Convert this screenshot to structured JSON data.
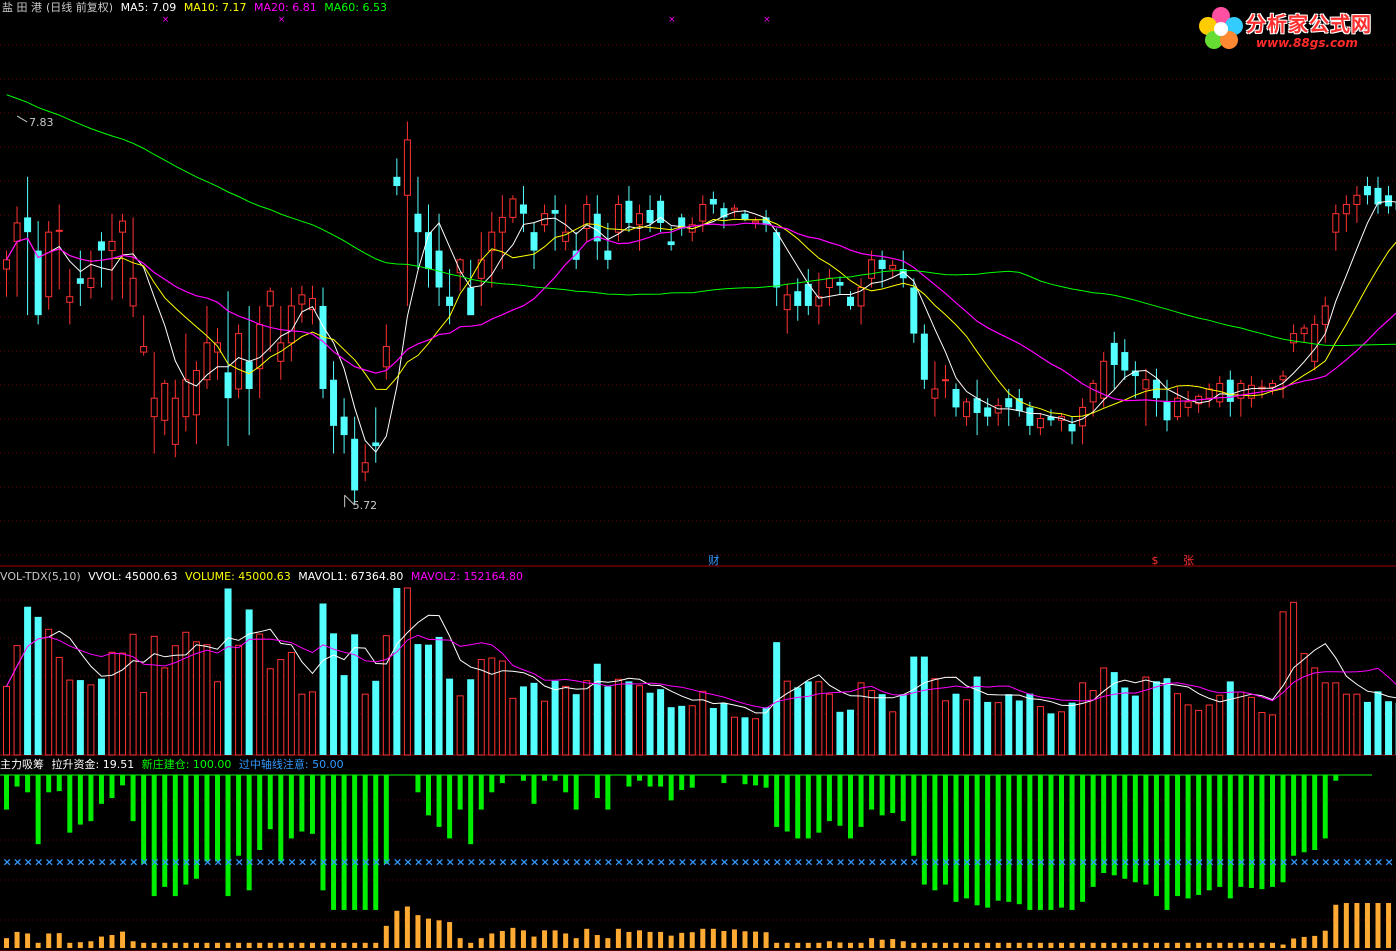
{
  "stock": {
    "name": "盐 田 港",
    "mode": "(日线 前复权)"
  },
  "ma_legend": [
    {
      "label": "MA5: 7.09",
      "color": "#ffffff"
    },
    {
      "label": "MA10: 7.17",
      "color": "#ffff00"
    },
    {
      "label": "MA20: 6.81",
      "color": "#ff00ff"
    },
    {
      "label": "MA60: 6.53",
      "color": "#00ff00"
    }
  ],
  "vol_legend": [
    {
      "label": "VOL-TDX(5,10)",
      "color": "#c8c8c8"
    },
    {
      "label": "VVOL: 45000.63",
      "color": "#ffffff"
    },
    {
      "label": "VOLUME: 45000.63",
      "color": "#ffff00"
    },
    {
      "label": "MAVOL1: 67364.80",
      "color": "#ffffff"
    },
    {
      "label": "MAVOL2: 152164.80",
      "color": "#ff00ff"
    }
  ],
  "ind_legend": [
    {
      "label": "主力吸筹",
      "color": "#ffffff"
    },
    {
      "label": "拉升资金: 19.51",
      "color": "#ffffff"
    },
    {
      "label": "新庄建仓: 100.00",
      "color": "#00ff00"
    },
    {
      "label": "过中轴线注意: 50.00",
      "color": "#3399ff"
    }
  ],
  "logo": {
    "name": "分析家公式网",
    "url": "www.88gs.com"
  },
  "markers": [
    {
      "text": "财",
      "color": "#3399ff",
      "index": 67
    },
    {
      "text": "$",
      "color": "#ff3030",
      "index": 109
    },
    {
      "text": "张",
      "color": "#ff3030",
      "index": 112
    }
  ],
  "chart_data": {
    "type": "candlestick",
    "price_range": [
      5.45,
      8.35
    ],
    "high_label": "7.83",
    "low_label": "5.72",
    "ohlc": [
      [
        7.0,
        7.1,
        6.85,
        7.05
      ],
      [
        7.15,
        7.34,
        6.85,
        7.25
      ],
      [
        7.28,
        7.5,
        6.75,
        7.2
      ],
      [
        7.1,
        7.26,
        6.7,
        6.75
      ],
      [
        6.85,
        7.26,
        6.78,
        7.2
      ],
      [
        7.21,
        7.35,
        6.89,
        7.21
      ],
      [
        6.82,
        7.0,
        6.7,
        6.85
      ],
      [
        6.95,
        7.1,
        6.8,
        6.92
      ],
      [
        6.9,
        7.1,
        6.84,
        6.95
      ],
      [
        7.15,
        7.2,
        6.9,
        7.1
      ],
      [
        7.1,
        7.3,
        6.83,
        7.15
      ],
      [
        7.2,
        7.3,
        6.84,
        7.26
      ],
      [
        6.8,
        7.28,
        6.74,
        6.95
      ],
      [
        6.55,
        6.75,
        6.53,
        6.58
      ],
      [
        6.2,
        6.55,
        6.0,
        6.3
      ],
      [
        6.18,
        6.4,
        6.1,
        6.38
      ],
      [
        6.05,
        6.4,
        5.98,
        6.3
      ],
      [
        6.2,
        6.65,
        6.12,
        6.4
      ],
      [
        6.21,
        6.5,
        6.05,
        6.45
      ],
      [
        6.4,
        6.8,
        6.35,
        6.6
      ],
      [
        6.55,
        6.68,
        6.4,
        6.6
      ],
      [
        6.44,
        6.88,
        6.04,
        6.3
      ],
      [
        6.35,
        6.7,
        6.3,
        6.65
      ],
      [
        6.5,
        6.8,
        6.1,
        6.35
      ],
      [
        6.46,
        6.8,
        6.3,
        6.7
      ],
      [
        6.8,
        6.9,
        6.55,
        6.88
      ],
      [
        6.5,
        6.8,
        6.4,
        6.6
      ],
      [
        6.6,
        6.9,
        6.5,
        6.8
      ],
      [
        6.81,
        6.91,
        6.71,
        6.86
      ],
      [
        6.78,
        6.91,
        6.7,
        6.84
      ],
      [
        6.8,
        6.9,
        6.3,
        6.35
      ],
      [
        6.4,
        6.5,
        6.0,
        6.15
      ],
      [
        6.2,
        6.3,
        6.0,
        6.1
      ],
      [
        6.08,
        6.2,
        5.72,
        5.8
      ],
      [
        5.9,
        6.05,
        5.85,
        5.95
      ],
      [
        6.06,
        6.25,
        5.95,
        6.04
      ],
      [
        6.47,
        6.7,
        6.4,
        6.58
      ],
      [
        7.5,
        7.6,
        7.4,
        7.45
      ],
      [
        7.4,
        7.8,
        6.8,
        7.7
      ],
      [
        7.3,
        7.5,
        7.0,
        7.2
      ],
      [
        7.2,
        7.35,
        6.9,
        7.0
      ],
      [
        7.1,
        7.3,
        6.8,
        6.9
      ],
      [
        6.85,
        7.0,
        6.7,
        6.8
      ],
      [
        6.98,
        7.06,
        6.88,
        7.05
      ],
      [
        6.9,
        7.05,
        6.8,
        6.75
      ],
      [
        6.95,
        7.2,
        6.8,
        7.05
      ],
      [
        7.1,
        7.31,
        6.9,
        7.2
      ],
      [
        7.2,
        7.4,
        7.0,
        7.28
      ],
      [
        7.28,
        7.4,
        7.25,
        7.38
      ],
      [
        7.35,
        7.45,
        7.2,
        7.3
      ],
      [
        7.2,
        7.25,
        7.0,
        7.1
      ],
      [
        7.24,
        7.35,
        7.2,
        7.3
      ],
      [
        7.32,
        7.4,
        7.1,
        7.3
      ],
      [
        7.15,
        7.35,
        7.1,
        7.2
      ],
      [
        7.1,
        7.2,
        7.0,
        7.05
      ],
      [
        7.22,
        7.4,
        7.15,
        7.35
      ],
      [
        7.3,
        7.4,
        7.05,
        7.15
      ],
      [
        7.1,
        7.25,
        7.0,
        7.05
      ],
      [
        7.2,
        7.4,
        7.15,
        7.35
      ],
      [
        7.37,
        7.45,
        7.2,
        7.25
      ],
      [
        7.24,
        7.35,
        7.1,
        7.3
      ],
      [
        7.32,
        7.4,
        7.2,
        7.25
      ],
      [
        7.37,
        7.4,
        7.2,
        7.25
      ],
      [
        7.15,
        7.23,
        7.1,
        7.13
      ],
      [
        7.28,
        7.3,
        7.18,
        7.22
      ],
      [
        7.2,
        7.28,
        7.15,
        7.24
      ],
      [
        7.26,
        7.4,
        7.2,
        7.35
      ],
      [
        7.38,
        7.42,
        7.3,
        7.35
      ],
      [
        7.33,
        7.36,
        7.22,
        7.28
      ],
      [
        7.32,
        7.35,
        7.28,
        7.33
      ],
      [
        7.3,
        7.32,
        7.26,
        7.27
      ],
      [
        7.25,
        7.28,
        7.22,
        7.26
      ],
      [
        7.28,
        7.32,
        7.2,
        7.24
      ],
      [
        7.2,
        7.22,
        6.8,
        6.9
      ],
      [
        6.78,
        6.92,
        6.65,
        6.86
      ],
      [
        6.88,
        6.95,
        6.72,
        6.8
      ],
      [
        6.92,
        7.0,
        6.75,
        6.8
      ],
      [
        6.8,
        6.98,
        6.7,
        6.85
      ],
      [
        6.9,
        7.0,
        6.8,
        6.95
      ],
      [
        6.93,
        6.96,
        6.86,
        6.91
      ],
      [
        6.85,
        6.88,
        6.78,
        6.8
      ],
      [
        6.8,
        6.95,
        6.7,
        6.9
      ],
      [
        6.95,
        7.1,
        6.9,
        7.05
      ],
      [
        7.05,
        7.1,
        6.9,
        7.0
      ],
      [
        7.0,
        7.05,
        6.95,
        7.02
      ],
      [
        7.0,
        7.1,
        6.9,
        6.95
      ],
      [
        6.9,
        6.95,
        6.6,
        6.65
      ],
      [
        6.65,
        6.7,
        6.35,
        6.4
      ],
      [
        6.3,
        6.5,
        6.2,
        6.35
      ],
      [
        6.4,
        6.48,
        6.3,
        6.4
      ],
      [
        6.35,
        6.38,
        6.2,
        6.25
      ],
      [
        6.2,
        6.3,
        6.15,
        6.28
      ],
      [
        6.3,
        6.4,
        6.1,
        6.22
      ],
      [
        6.25,
        6.3,
        6.15,
        6.2
      ],
      [
        6.22,
        6.3,
        6.15,
        6.26
      ],
      [
        6.3,
        6.35,
        6.15,
        6.25
      ],
      [
        6.3,
        6.35,
        6.2,
        6.23
      ],
      [
        6.25,
        6.28,
        6.1,
        6.15
      ],
      [
        6.14,
        6.22,
        6.1,
        6.19
      ],
      [
        6.2,
        6.24,
        6.15,
        6.18
      ],
      [
        6.18,
        6.22,
        6.12,
        6.2
      ],
      [
        6.16,
        6.2,
        6.05,
        6.12
      ],
      [
        6.15,
        6.3,
        6.05,
        6.25
      ],
      [
        6.28,
        6.4,
        6.2,
        6.38
      ],
      [
        6.3,
        6.55,
        6.25,
        6.5
      ],
      [
        6.6,
        6.66,
        6.35,
        6.48
      ],
      [
        6.55,
        6.62,
        6.4,
        6.45
      ],
      [
        6.45,
        6.5,
        6.3,
        6.42
      ],
      [
        6.35,
        6.46,
        6.15,
        6.4
      ],
      [
        6.4,
        6.46,
        6.2,
        6.3
      ],
      [
        6.28,
        6.4,
        6.12,
        6.18
      ],
      [
        6.2,
        6.36,
        6.18,
        6.3
      ],
      [
        6.25,
        6.34,
        6.2,
        6.28
      ],
      [
        6.27,
        6.32,
        6.22,
        6.31
      ],
      [
        6.3,
        6.38,
        6.25,
        6.35
      ],
      [
        6.28,
        6.42,
        6.25,
        6.38
      ],
      [
        6.4,
        6.45,
        6.2,
        6.28
      ],
      [
        6.3,
        6.4,
        6.2,
        6.38
      ],
      [
        6.3,
        6.42,
        6.25,
        6.37
      ],
      [
        6.35,
        6.4,
        6.3,
        6.36
      ],
      [
        6.36,
        6.4,
        6.32,
        6.38
      ],
      [
        6.4,
        6.45,
        6.3,
        6.42
      ],
      [
        6.6,
        6.7,
        6.55,
        6.65
      ],
      [
        6.65,
        6.7,
        6.6,
        6.68
      ],
      [
        6.5,
        6.75,
        6.45,
        6.7
      ],
      [
        6.7,
        6.85,
        6.6,
        6.8
      ],
      [
        7.2,
        7.35,
        7.1,
        7.3
      ],
      [
        7.3,
        7.4,
        7.2,
        7.35
      ],
      [
        7.35,
        7.45,
        7.25,
        7.4
      ],
      [
        7.45,
        7.5,
        7.35,
        7.4
      ],
      [
        7.44,
        7.5,
        7.3,
        7.35
      ],
      [
        7.4,
        7.45,
        7.3,
        7.34
      ],
      [
        7.36,
        7.4,
        7.25,
        7.32
      ],
      [
        7.32,
        7.35,
        7.25,
        7.3
      ],
      [
        7.3,
        7.4,
        7.25,
        7.35
      ],
      [
        7.35,
        7.4,
        7.3,
        7.33
      ]
    ],
    "volume_range": [
      0,
      140000
    ],
    "volume": [],
    "indicator_range": [
      0,
      100
    ]
  }
}
